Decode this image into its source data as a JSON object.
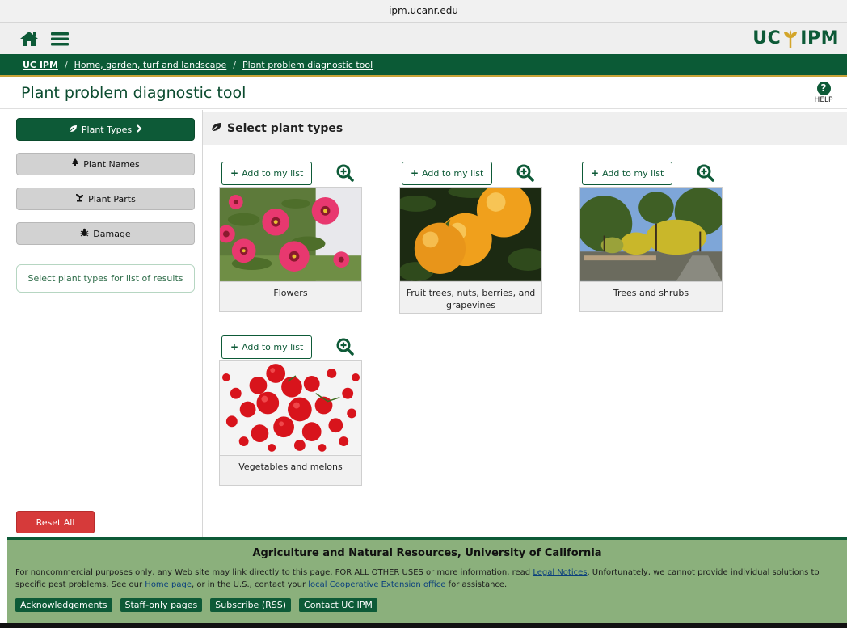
{
  "browser": {
    "url": "ipm.ucanr.edu"
  },
  "header": {
    "logo_left": "UC",
    "logo_right": "IPM"
  },
  "breadcrumb": {
    "items": [
      "UC IPM",
      "Home, garden, turf and landscape",
      "Plant problem diagnostic tool"
    ],
    "separator": "/"
  },
  "page": {
    "title": "Plant problem diagnostic tool",
    "help_label": "HELP",
    "help_glyph": "?"
  },
  "sidebar": {
    "buttons": [
      {
        "label": "Plant Types",
        "icon": "leaf-icon",
        "active": true
      },
      {
        "label": "Plant Names",
        "icon": "tree-icon",
        "active": false
      },
      {
        "label": "Plant Parts",
        "icon": "plant-parts-icon",
        "active": false
      },
      {
        "label": "Damage",
        "icon": "bug-icon",
        "active": false
      }
    ],
    "hint": "Select plant types for list of results",
    "reset_label": "Reset All"
  },
  "section": {
    "title": "Select plant types"
  },
  "cards": [
    {
      "add_label": "Add to my list",
      "caption": "Flowers",
      "image": "pink-daisy-flowers"
    },
    {
      "add_label": "Add to my list",
      "caption": "Fruit trees, nuts, berries, and grapevines",
      "image": "oranges-on-tree"
    },
    {
      "add_label": "Add to my list",
      "caption": "Trees and shrubs",
      "image": "trees-along-path"
    },
    {
      "add_label": "Add to my list",
      "caption": "Vegetables and melons",
      "image": "red-tomatoes"
    }
  ],
  "footer": {
    "title": "Agriculture and Natural Resources, University of California",
    "text_1": "For noncommercial purposes only, any Web site may link directly to this page. FOR ALL OTHER USES or more information, read ",
    "link_legal": "Legal Notices",
    "text_2": ". Unfortunately, we cannot provide individual solutions to specific pest problems. See our ",
    "link_home": "Home page",
    "text_3": ", or in the U.S., contact your ",
    "link_local": "local Cooperative Extension office",
    "text_4": " for assistance.",
    "links": [
      "Acknowledgements",
      "Staff-only pages",
      "Subscribe (RSS)",
      "Contact UC IPM"
    ]
  },
  "colors": {
    "brand_green": "#0d5a37",
    "gold": "#c9a338",
    "footer_green": "#8bb07c",
    "reset_red": "#d63a3a"
  }
}
